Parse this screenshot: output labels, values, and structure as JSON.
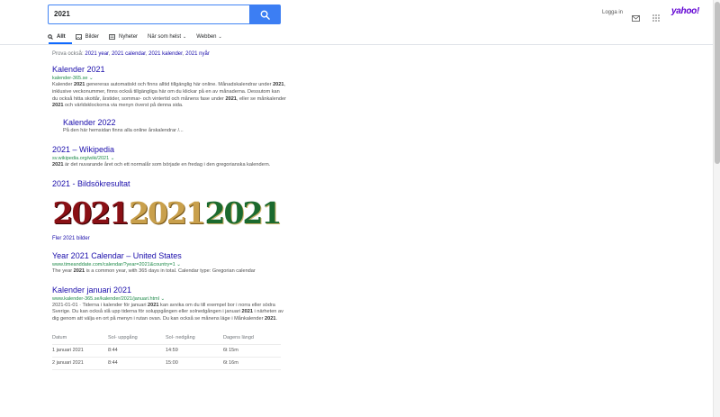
{
  "search": {
    "query": "2021"
  },
  "tabs": [
    {
      "label": "Allt",
      "icon": "search-icon"
    },
    {
      "label": "Bilder",
      "icon": "image-icon"
    },
    {
      "label": "Nyheter",
      "icon": "news-icon"
    },
    {
      "label": "När som helst",
      "icon": ""
    },
    {
      "label": "Webben",
      "icon": ""
    }
  ],
  "header": {
    "login": "Logga in",
    "logo": "yahoo!"
  },
  "also": {
    "prefix": "Prova också:",
    "links": [
      "2021 year",
      "2021 calendar",
      "2021 kalender",
      "2021 nyår"
    ]
  },
  "results": [
    {
      "title": "Kalender 2021",
      "url": "kalender-365.se",
      "desc_parts": [
        [
          "Kalender ",
          false
        ],
        [
          "2021",
          true
        ],
        [
          " genereras automatiskt och finns alltid tillgänglig här online. Månadskalendrar under ",
          false
        ],
        [
          "2021",
          true
        ],
        [
          ", inklusive veckonummer, finns också tillgängliga här om du klickar på en av månaderna. Dessutom kan du också hitta skottår, årstider, sommar- och vintertid och månens fase under ",
          false
        ],
        [
          "2021",
          true
        ],
        [
          ", eller se månkalender ",
          false
        ],
        [
          "2021",
          true
        ],
        [
          " och världsklockorna via menyn överst på denna sida.",
          false
        ]
      ],
      "sub": {
        "title": "Kalender 2022",
        "desc": "På den här hemsidan finns alla online årskalendrar /..."
      }
    },
    {
      "title": "2021 – Wikipedia",
      "url": "sv.wikipedia.org/wiki/2021",
      "desc_parts": [
        [
          "2021",
          true
        ],
        [
          " är det nuvarande året och ett normalår som började en fredag i den gregorianska kalendern.",
          false
        ]
      ]
    }
  ],
  "images": {
    "title": "2021 - Bildsökresultat",
    "labels": [
      "2021",
      "2021",
      "2021"
    ],
    "more": "Fler 2021 bilder"
  },
  "results2": [
    {
      "title": "Year 2021 Calendar – United States",
      "url": "www.timeanddate.com/calendar/?year=2021&country=1",
      "desc_parts": [
        [
          "The year ",
          false
        ],
        [
          "2021",
          true
        ],
        [
          " is a common year, with 365 days in total. Calendar type: Gregorian calendar",
          false
        ]
      ]
    },
    {
      "title": "Kalender januari 2021",
      "url": "www.kalender-365.se/kalender/2021/januari.html",
      "desc_parts": [
        [
          "2021-01-01 · Tiderna i kalender för januari ",
          false
        ],
        [
          "2021",
          true
        ],
        [
          " kan avvika om du till exempel bor i norra eller södra Sverige. Du kan också slå upp tiderna för soluppgången eller solnedgången i januari ",
          false
        ],
        [
          "2021",
          true
        ],
        [
          " i närheten av dig genom att välja en ort på menyn i rutan ovan. Du kan också se månens läge i Månkalender ",
          false
        ],
        [
          "2021",
          true
        ],
        [
          ".",
          false
        ]
      ]
    }
  ],
  "table": {
    "headers": [
      "Datum",
      "Sol- uppgång",
      "Sol- nedgång",
      "Dagens längd"
    ],
    "rows": [
      [
        "1 januari 2021",
        "8:44",
        "14:59",
        "6t 15m"
      ],
      [
        "2 januari 2021",
        "8:44",
        "15:00",
        "6t 16m"
      ]
    ]
  },
  "colors": {
    "accent": "#3c7ef3",
    "link": "#1a0dab",
    "url": "#1e8a49",
    "brand": "#6001d2"
  }
}
